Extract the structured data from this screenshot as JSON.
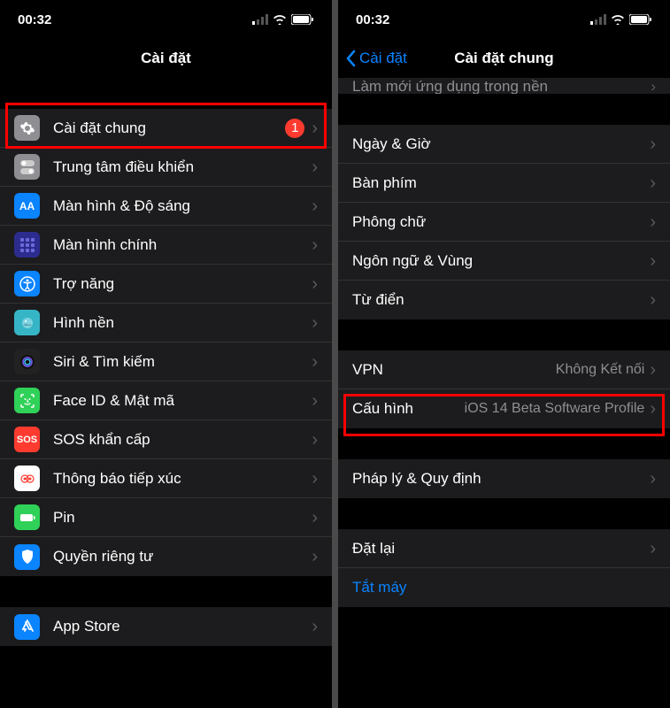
{
  "status": {
    "time": "00:32"
  },
  "left": {
    "title": "Cài đặt",
    "rows": [
      {
        "label": "Cài đặt chung",
        "badge": "1",
        "icon": "gear"
      },
      {
        "label": "Trung tâm điều khiển",
        "icon": "control"
      },
      {
        "label": "Màn hình & Độ sáng",
        "icon": "display"
      },
      {
        "label": "Màn hình chính",
        "icon": "home"
      },
      {
        "label": "Trợ năng",
        "icon": "access"
      },
      {
        "label": "Hình nền",
        "icon": "wallpaper"
      },
      {
        "label": "Siri & Tìm kiếm",
        "icon": "siri"
      },
      {
        "label": "Face ID & Mật mã",
        "icon": "faceid"
      },
      {
        "label": "SOS khẩn cấp",
        "icon": "sos"
      },
      {
        "label": "Thông báo tiếp xúc",
        "icon": "exposure"
      },
      {
        "label": "Pin",
        "icon": "battery"
      },
      {
        "label": "Quyền riêng tư",
        "icon": "privacy"
      }
    ],
    "rows2": [
      {
        "label": "App Store",
        "icon": "appstore"
      }
    ]
  },
  "right": {
    "back": "Cài đặt",
    "title": "Cài đặt chung",
    "partial": "Làm mới ứng dụng trong nền",
    "group1": [
      {
        "label": "Ngày & Giờ"
      },
      {
        "label": "Bàn phím"
      },
      {
        "label": "Phông chữ"
      },
      {
        "label": "Ngôn ngữ & Vùng"
      },
      {
        "label": "Từ điển"
      }
    ],
    "group2": [
      {
        "label": "VPN",
        "detail": "Không Kết nối"
      },
      {
        "label": "Cấu hình",
        "detail": "iOS 14 Beta Software Profile"
      }
    ],
    "group3": [
      {
        "label": "Pháp lý & Quy định"
      }
    ],
    "group4": [
      {
        "label": "Đặt lại"
      },
      {
        "label": "Tắt máy",
        "link": true
      }
    ]
  }
}
